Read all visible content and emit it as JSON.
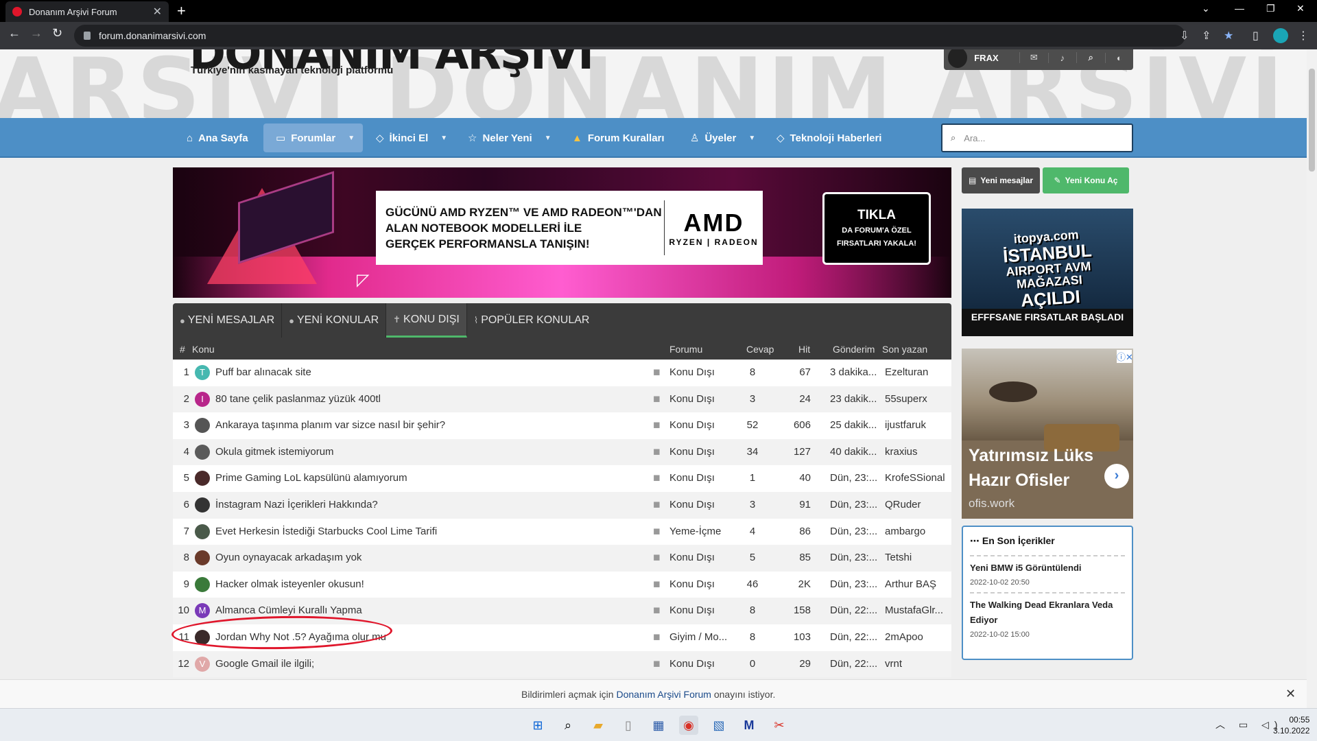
{
  "browser": {
    "tab_title": "Donanım Arşivi Forum",
    "tab_close": "✕",
    "new_tab": "+",
    "url": "forum.donanimarsivi.com"
  },
  "site": {
    "logo_text": "DONANIM ARŞİVİ",
    "tagline": "Türkiye'nin kasmayan teknoloji platformu",
    "user_name": "FRAX"
  },
  "nav": {
    "items": [
      {
        "label": "Ana Sayfa",
        "icon": "home-icon"
      },
      {
        "label": "Forumlar",
        "icon": "chat-icon"
      },
      {
        "label": "İkinci El",
        "icon": "tag-icon"
      },
      {
        "label": "Neler Yeni",
        "icon": "star-icon"
      },
      {
        "label": "Forum Kuralları",
        "icon": "warning-icon"
      },
      {
        "label": "Üyeler",
        "icon": "user-icon"
      },
      {
        "label": "Teknoloji Haberleri",
        "icon": "tag-icon"
      }
    ],
    "search_placeholder": "Ara..."
  },
  "ad_banner": {
    "text_line1": "GÜCÜNÜ AMD RYZEN™ VE AMD RADEON™'DAN",
    "text_line2": "ALAN NOTEBOOK MODELLERİ İLE",
    "text_line3": "GERÇEK PERFORMANSLA TANIŞIN!",
    "brand": "AMD",
    "brand_sub": "RYZEN | RADEON",
    "cta_title": "TIKLA",
    "cta_line1": "DA FORUM'A ÖZEL",
    "cta_line2": "FIRSATLARI YAKALA!"
  },
  "tabs": [
    {
      "label": "YENİ MESAJLAR",
      "selected": false
    },
    {
      "label": "YENİ KONULAR",
      "selected": false
    },
    {
      "label": "KONU DIŞI",
      "selected": true
    },
    {
      "label": "POPÜLER KONULAR",
      "selected": false
    }
  ],
  "table": {
    "headers": {
      "num": "#",
      "topic": "Konu",
      "forum": "Forumu",
      "replies": "Cevap",
      "hits": "Hit",
      "date": "Gönderim",
      "author": "Son yazan"
    },
    "rows": [
      {
        "n": "1",
        "avatar": "T",
        "avatar_color": "#46b8b0",
        "title": "Puff bar alınacak site",
        "forum": "Konu Dışı",
        "replies": "8",
        "hits": "67",
        "date": "3 dakika...",
        "author": "Ezelturan"
      },
      {
        "n": "2",
        "avatar": "I",
        "avatar_color": "#b8268a",
        "title": "80 tane çelik paslanmaz yüzük 400tl",
        "forum": "Konu Dışı",
        "replies": "3",
        "hits": "24",
        "date": "23 dakik...",
        "author": "55superx"
      },
      {
        "n": "3",
        "avatar": "",
        "avatar_color": "#555555",
        "title": "Ankaraya taşınma planım var sizce nasıl bir şehir?",
        "forum": "Konu Dışı",
        "replies": "52",
        "hits": "606",
        "date": "25 dakik...",
        "author": "ijustfaruk"
      },
      {
        "n": "4",
        "avatar": "",
        "avatar_color": "#5a5a5a",
        "title": "Okula gitmek istemiyorum",
        "forum": "Konu Dışı",
        "replies": "34",
        "hits": "127",
        "date": "40 dakik...",
        "author": "kraxius"
      },
      {
        "n": "5",
        "avatar": "",
        "avatar_color": "#4a2a2a",
        "title": "Prime Gaming LoL kapsülünü alamıyorum",
        "forum": "Konu Dışı",
        "replies": "1",
        "hits": "40",
        "date": "Dün, 23:...",
        "author": "KrofeSSional"
      },
      {
        "n": "6",
        "avatar": "",
        "avatar_color": "#333333",
        "title": "İnstagram Nazi İçerikleri Hakkında?",
        "forum": "Konu Dışı",
        "replies": "3",
        "hits": "91",
        "date": "Dün, 23:...",
        "author": "QRuder"
      },
      {
        "n": "7",
        "avatar": "",
        "avatar_color": "#4a5a4a",
        "title": "Evet Herkesin İstediği Starbucks Cool Lime Tarifi",
        "forum": "Yeme-İçme",
        "replies": "4",
        "hits": "86",
        "date": "Dün, 23:...",
        "author": "ambargo"
      },
      {
        "n": "8",
        "avatar": "",
        "avatar_color": "#6a3a2a",
        "title": "Oyun oynayacak arkadaşım yok",
        "forum": "Konu Dışı",
        "replies": "5",
        "hits": "85",
        "date": "Dün, 23:...",
        "author": "Tetshi"
      },
      {
        "n": "9",
        "avatar": "",
        "avatar_color": "#3a7a3a",
        "title": "Hacker olmak isteyenler okusun!",
        "forum": "Konu Dışı",
        "replies": "46",
        "hits": "2K",
        "date": "Dün, 23:...",
        "author": "Arthur BAŞ"
      },
      {
        "n": "10",
        "avatar": "M",
        "avatar_color": "#7a3ab8",
        "title": "Almanca Cümleyi Kurallı Yapma",
        "forum": "Konu Dışı",
        "replies": "8",
        "hits": "158",
        "date": "Dün, 22:...",
        "author": "MustafaGlr..."
      },
      {
        "n": "11",
        "avatar": "",
        "avatar_color": "#3a2a2a",
        "title": "Jordan Why Not .5? Ayağıma olur mu",
        "forum": "Giyim / Mo...",
        "replies": "8",
        "hits": "103",
        "date": "Dün, 22:...",
        "author": "2mApoo"
      },
      {
        "n": "12",
        "avatar": "V",
        "avatar_color": "#e0a8a8",
        "title": "Google Gmail ile ilgili;",
        "forum": "Konu Dışı",
        "replies": "0",
        "hits": "29",
        "date": "Dün, 22:...",
        "author": "vrnt"
      }
    ]
  },
  "sidebar": {
    "new_messages": "Yeni mesajlar",
    "new_topic": "Yeni Konu Aç",
    "ad2": {
      "l1": "itopya.com",
      "l2": "İSTANBUL",
      "l3": "AIRPORT AVM",
      "l4": "MAĞAZASI",
      "l5": "AÇILDI",
      "foot": "EFFFSANE FIRSATLAR BAŞLADI"
    },
    "ad3": {
      "title": "Yatırımsız Lüks Hazır Ofisler",
      "domain": "ofis.work"
    },
    "recent": {
      "title": "En Son İçerikler",
      "items": [
        {
          "title": "Yeni BMW i5 Görüntülendi",
          "date": "2022-10-02 20:50"
        },
        {
          "title": "The Walking Dead Ekranlara Veda Ediyor",
          "date": "2022-10-02 15:00"
        }
      ]
    }
  },
  "notification": {
    "prefix": "Bildirimleri açmak için",
    "site": "Donanım Arşivi Forum",
    "suffix": "onayını istiyor.",
    "close": "✕"
  },
  "taskbar": {
    "time": "00:55",
    "date": "3.10.2022"
  },
  "colors": {
    "accent": "#4d8fc6",
    "brand_red": "#e0162b",
    "green": "#4fb86b"
  }
}
